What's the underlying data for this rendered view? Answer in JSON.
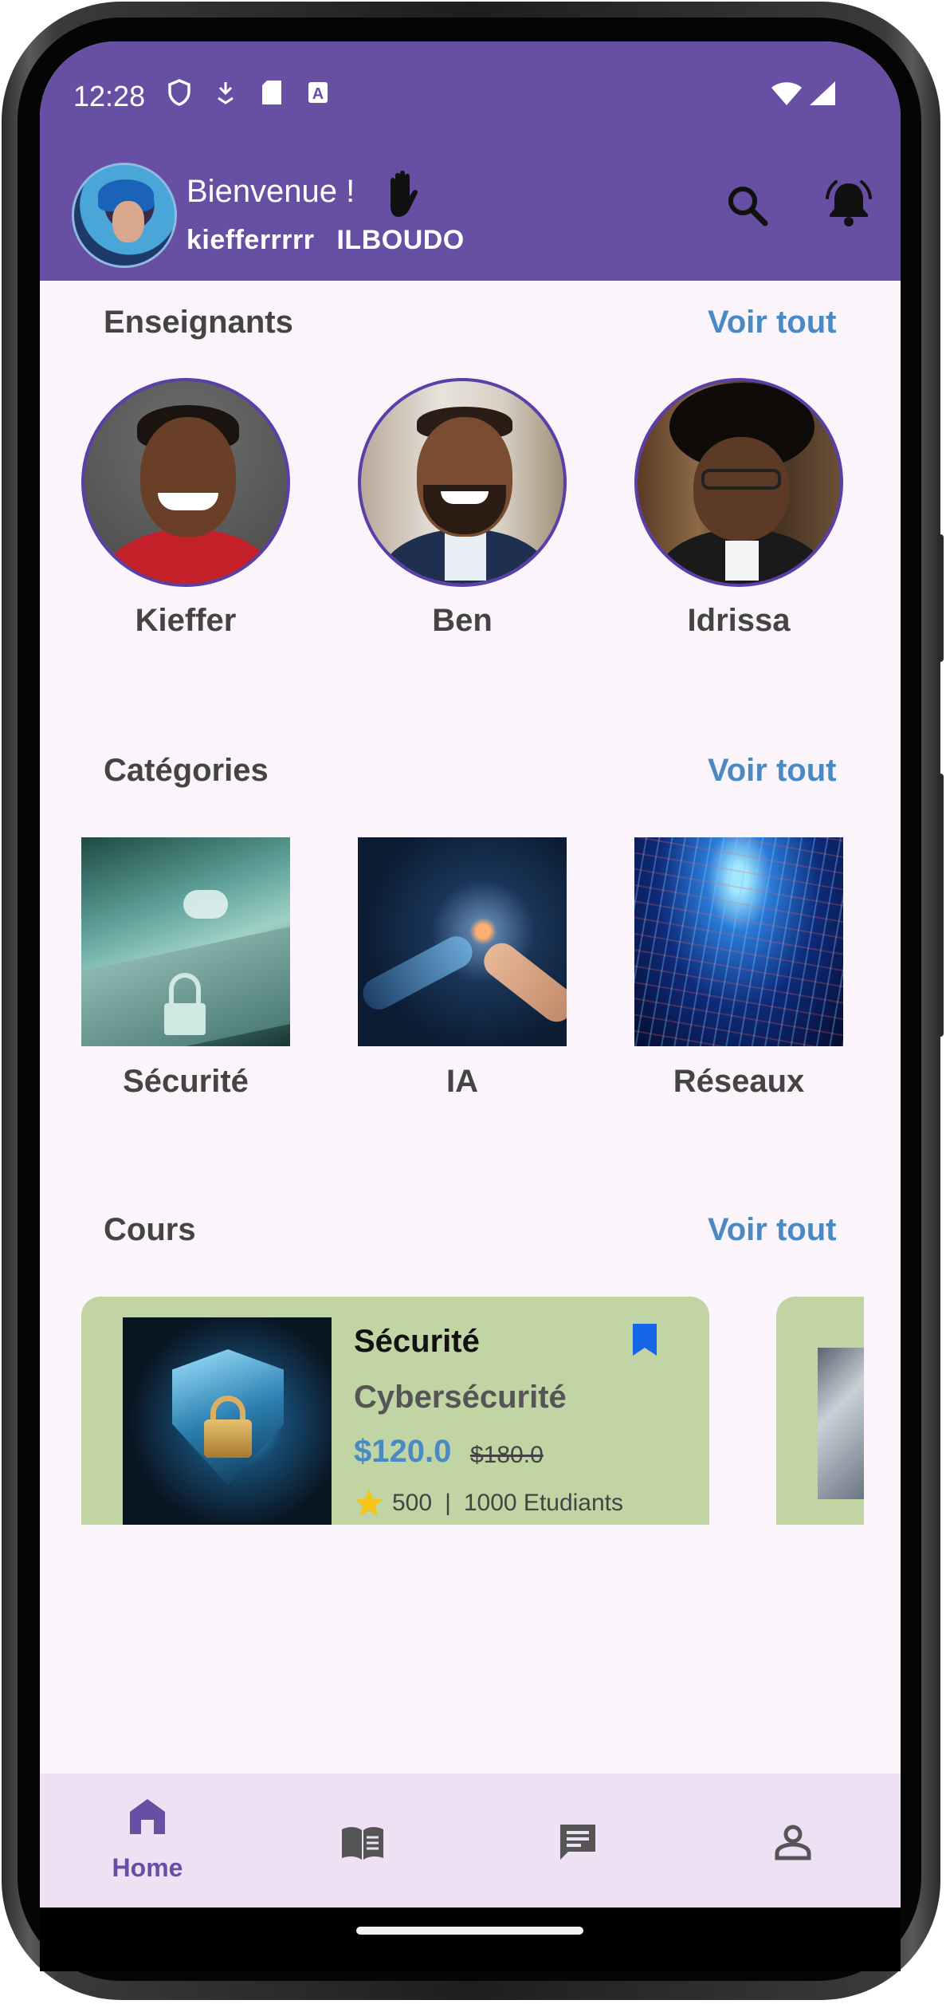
{
  "status_bar": {
    "time": "12:28"
  },
  "header": {
    "welcome": "Bienvenue !",
    "first_name": "kiefferrrrr",
    "last_name": "ILBOUDO",
    "background_color": "#6750a4"
  },
  "teachers_section": {
    "title": "Enseignants",
    "see_all": "Voir tout",
    "items": [
      {
        "name": "Kieffer"
      },
      {
        "name": "Ben"
      },
      {
        "name": "Idrissa"
      }
    ]
  },
  "categories_section": {
    "title": "Catégories",
    "see_all": "Voir tout",
    "items": [
      {
        "label": "Sécurité"
      },
      {
        "label": "IA"
      },
      {
        "label": "Réseaux"
      }
    ]
  },
  "courses_section": {
    "title": "Cours",
    "see_all": "Voir tout",
    "cards": [
      {
        "category": "Sécurité",
        "title": "Cybersécurité",
        "price": "$120.0",
        "old_price": "$180.0",
        "rating_count": "500",
        "separator": "|",
        "students": "1000 Etudiants"
      }
    ]
  },
  "bottom_nav": {
    "items": [
      {
        "label": "Home",
        "icon": "home-icon",
        "active": true
      },
      {
        "label": "",
        "icon": "book-icon",
        "active": false
      },
      {
        "label": "",
        "icon": "chat-icon",
        "active": false
      },
      {
        "label": "",
        "icon": "person-icon",
        "active": false
      }
    ]
  },
  "colors": {
    "accent": "#6750a4",
    "link": "#4a8ac4",
    "card": "#c0d4a4",
    "nav_background": "#ede1f3",
    "screen_background": "#fcf4fb"
  }
}
